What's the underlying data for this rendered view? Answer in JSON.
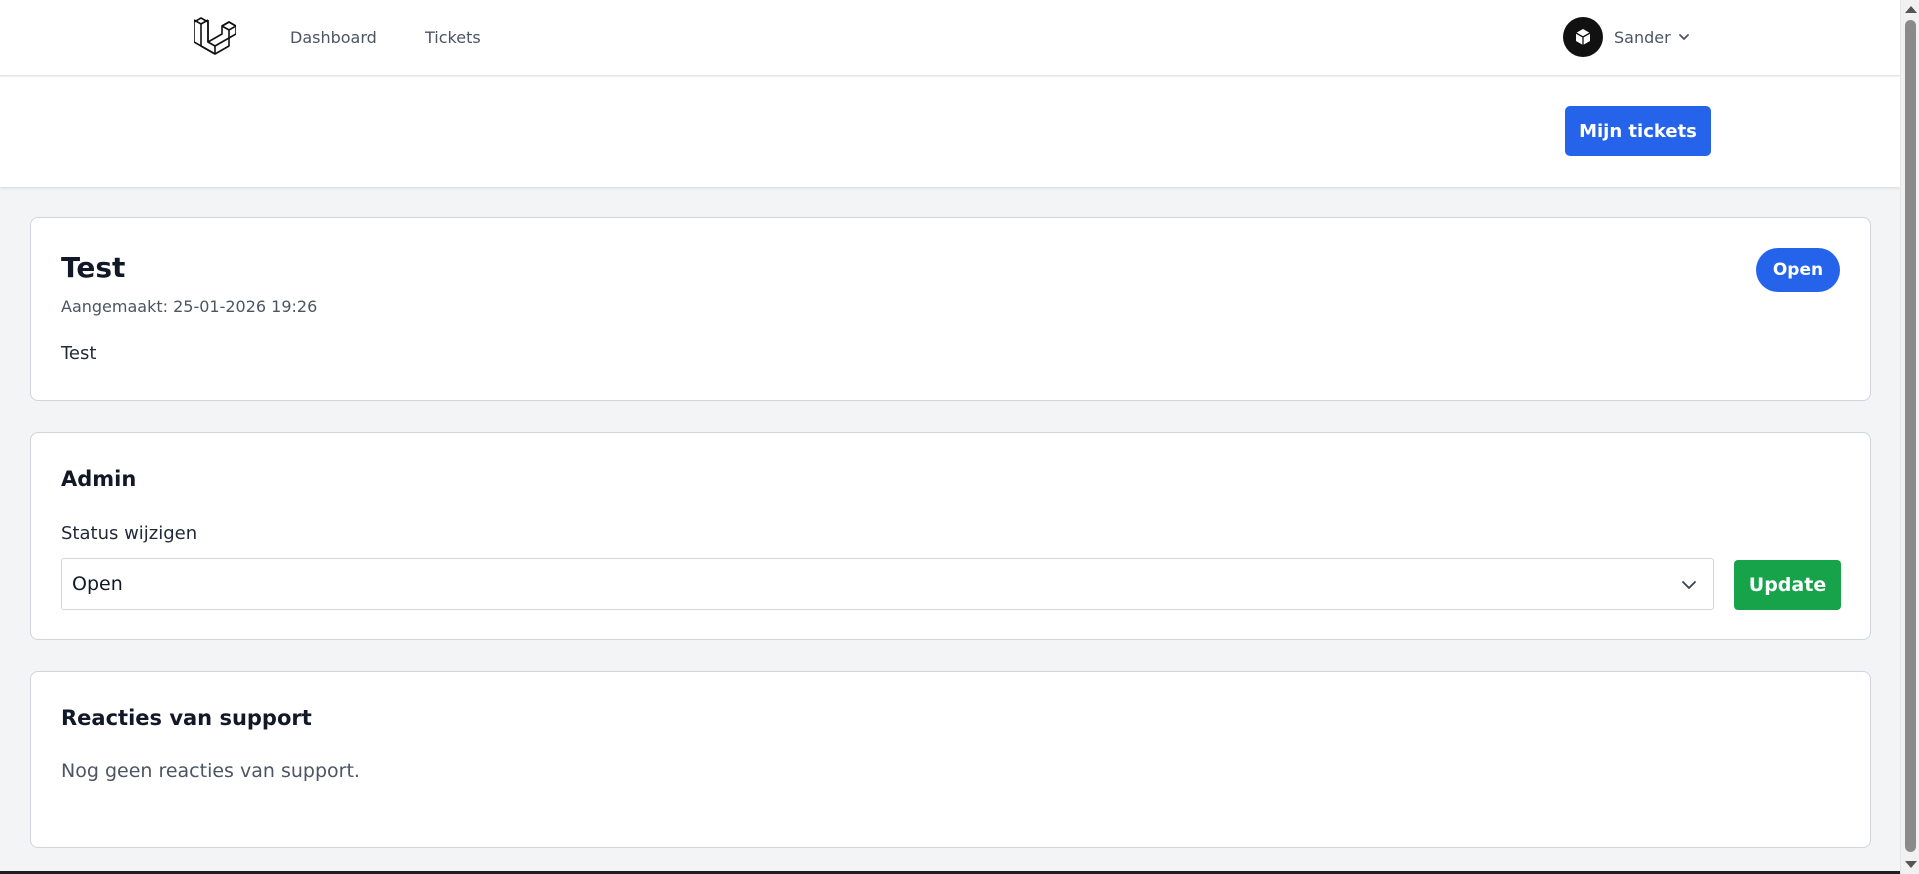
{
  "nav": {
    "links": [
      "Dashboard",
      "Tickets"
    ],
    "user_name": "Sander"
  },
  "header": {
    "my_tickets_label": "Mijn tickets"
  },
  "ticket": {
    "title": "Test",
    "created": "Aangemaakt: 25-01-2026 19:26",
    "body": "Test",
    "status_badge": "Open",
    "status_color": "#2563eb"
  },
  "admin": {
    "title": "Admin",
    "status_label": "Status wijzigen",
    "selected_status": "Open",
    "update_label": "Update",
    "update_color": "#16a34a"
  },
  "replies": {
    "title": "Reacties van support",
    "empty_text": "Nog geen reacties van support."
  }
}
